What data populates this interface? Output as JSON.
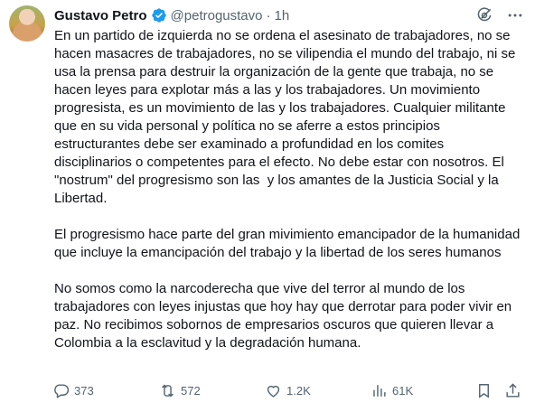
{
  "author": {
    "name": "Gustavo Petro",
    "handle": "@petrogustavo",
    "separator": "·",
    "time": "1h"
  },
  "icons": {
    "verified": "verified-badge-icon",
    "grok": "grok-icon",
    "more": "more-options-icon",
    "reply": "reply-icon",
    "repost": "repost-icon",
    "like": "heart-icon",
    "views": "views-chart-icon",
    "bookmark": "bookmark-icon",
    "share": "share-icon"
  },
  "colors": {
    "verified": "#1d9bf0",
    "muted": "#536471",
    "text": "#0f1419"
  },
  "tweet": {
    "paragraphs": [
      "En un partido de izquierda no se ordena el asesinato de trabajadores, no se hacen masacres de trabajadores, no se vilipendia el mundo del trabajo, ni se usa la prensa para destruir la organización de la gente que trabaja, no se hacen leyes para explotar más a las y los trabajadores. Un movimiento progresista, es un movimiento de las y los trabajadores. Cualquier militante que en su vida personal y política no se aferre a estos principios estructurantes debe ser examinado a profundidad en los comites disciplinarios o competentes para el efecto. No debe estar con nosotros. El \"nostrum\" del progresismo son las  y los amantes de la Justicia Social y la Libertad.",
      "El progresismo hace parte del gran mivimiento emancipador de la humanidad que incluye la emancipación del trabajo y la libertad de los seres humanos",
      "No somos como la narcoderecha que vive del terror al mundo de los trabajadores con leyes injustas que hoy hay que derrotar para poder vivir en paz. No recibimos sobornos de empresarios oscuros que quieren llevar a Colombia a la esclavitud y la degradación humana."
    ]
  },
  "actions": {
    "replies": "373",
    "reposts": "572",
    "likes": "1.2K",
    "views": "61K"
  }
}
